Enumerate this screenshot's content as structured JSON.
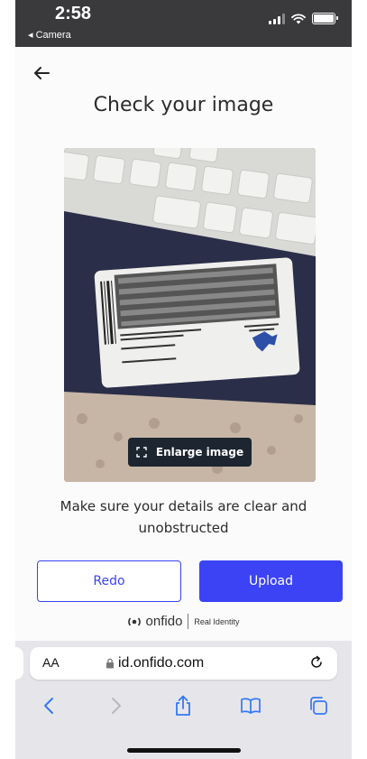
{
  "status_bar": {
    "time": "2:58",
    "back_app": "◂ Camera"
  },
  "page": {
    "title": "Check your image",
    "enlarge_label": "Enlarge image",
    "hint": "Make sure your details are clear and unobstructed",
    "redo_label": "Redo",
    "upload_label": "Upload",
    "brand": {
      "logo": "onfido",
      "tagline": "Real Identity"
    }
  },
  "browser": {
    "aa_label": "AA",
    "url": "id.onfido.com"
  },
  "colors": {
    "accent": "#3b43f5",
    "enlarge_bg": "#1d2630"
  },
  "icons": {
    "back": "arrow-left-icon",
    "enlarge": "expand-corners-icon",
    "lock": "lock-icon",
    "reload": "reload-icon",
    "toolbar": [
      "chevron-left-icon",
      "chevron-right-icon",
      "share-icon",
      "bookmarks-icon",
      "tabs-icon"
    ]
  }
}
